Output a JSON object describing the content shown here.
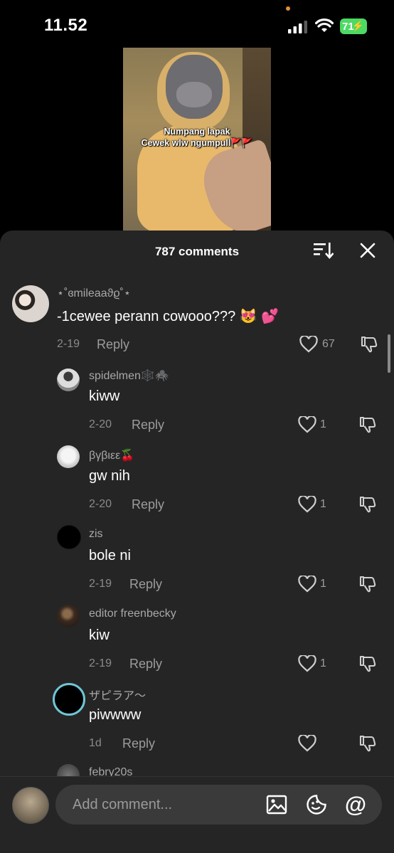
{
  "status": {
    "time": "11.52",
    "battery": "71"
  },
  "video": {
    "caption_line1": "Numpang lapak",
    "caption_line2": "Cewek wlw ngumpull🚩🚩"
  },
  "sheet": {
    "title": "787 comments"
  },
  "comments": [
    {
      "username": "⋆˚ɞmileaaϑϱ˚⋆",
      "text": "-1cewee perann cowooo??? 😻 💕",
      "date": "2-19",
      "reply": "Reply",
      "likes": "67"
    },
    {
      "username": "spidelmen🕸️🕷️",
      "text": "kiww",
      "date": "2-20",
      "reply": "Reply",
      "likes": "1"
    },
    {
      "username": "βγβιεε🍒",
      "text": "gw nih",
      "date": "2-20",
      "reply": "Reply",
      "likes": "1"
    },
    {
      "username": "zis",
      "text": "bole ni",
      "date": "2-19",
      "reply": "Reply",
      "likes": "1"
    },
    {
      "username": "editor freenbecky",
      "text": "kiw",
      "date": "2-19",
      "reply": "Reply",
      "likes": "1"
    },
    {
      "username": "ザピラア〜",
      "text": "piwwww",
      "date": "1d",
      "reply": "Reply",
      "likes": ""
    },
    {
      "username": "febry20s"
    }
  ],
  "input": {
    "placeholder": "Add comment..."
  },
  "colors": {
    "sheet_bg": "#252525",
    "battery": "#4cd964",
    "muted_text": "#a8a8a8"
  }
}
